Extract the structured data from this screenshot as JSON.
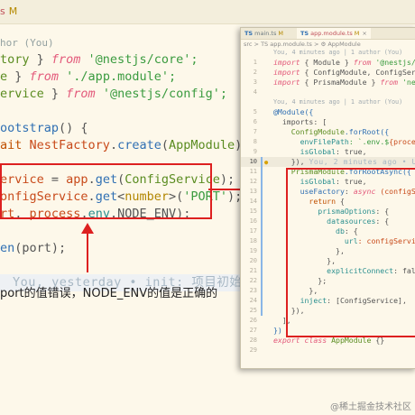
{
  "left_editor": {
    "tab": {
      "label": "s",
      "badge": "M"
    },
    "blame_top": "hor (You)",
    "lines": {
      "l1": {
        "a": "tory",
        "b": " } ",
        "c": "from",
        "d": " '@nestjs/core';"
      },
      "l2": {
        "a": "e",
        "b": " } ",
        "c": "from",
        "d": " './app.module';"
      },
      "l3": {
        "a": "ervice",
        "b": " } ",
        "c": "from",
        "d": " '@nestjs/config';"
      },
      "l4": {
        "a": "ootstrap",
        "b": "() {"
      },
      "l5": {
        "a": "ait",
        "b": " NestFactory",
        "c": ".",
        "d": "create",
        "e": "(",
        "f": "AppModule",
        "g": ");"
      },
      "l6": {
        "a": "ervice",
        "b": " = ",
        "c": "app",
        "d": ".",
        "e": "get",
        "f": "(",
        "g": "ConfigService",
        "h": ");"
      },
      "l7": {
        "a": "onfigService",
        "b": ".",
        "c": "get",
        "d": "<",
        "e": "number",
        "f": ">(",
        "g": "'PORT'",
        "h": ");"
      },
      "l8": {
        "a": "rt",
        "b": ", ",
        "c": "process",
        "d": ".",
        "e": "env",
        "f": ".NODE_ENV);"
      },
      "l9": {
        "a": "en",
        "b": "(port);"
      }
    },
    "yesterday_annotation": "You, yesterday • init: 项目初始化"
  },
  "caption": "port的值错误，NODE_ENV的值是正确的",
  "right_editor": {
    "tabs": [
      {
        "badge": "TS",
        "label": "main.ts",
        "mod": "M"
      },
      {
        "badge": "TS",
        "label": "app.module.ts",
        "mod": "M",
        "close": "×"
      }
    ],
    "breadcrumb": "src > TS app.module.ts > ⚙ AppModule",
    "blame1": "You, 4 minutes ago | 1 author (You)",
    "imports": [
      {
        "kw": "import",
        "body": " { Module } ",
        "from": "from",
        "src": " '@nestjs/com"
      },
      {
        "kw": "import",
        "body": " { ConfigModule, ConfigServic"
      },
      {
        "kw": "import",
        "body": " { PrismaModule } ",
        "from": "from",
        "src": " 'nestj"
      }
    ],
    "blame2": "You, 4 minutes ago | 1 author (You)",
    "code": {
      "c7": "@Module({",
      "c8": "  imports: [",
      "c9a": "    ConfigModule",
      "c9b": ".forRoot({",
      "c10a": "      envFilePath",
      "c10b": ": `.env.$",
      "c10c": "{process.",
      "c11a": "      isGlobal",
      "c11b": ": true,",
      "c12a": "    }),",
      "c12b": "You, 2 minutes ago • U",
      "c13a": "    PrismaModule",
      "c13b": ".forRootAsync({",
      "c14a": "      isGlobal",
      "c14b": ": true,",
      "c15a": "      useFactory",
      "c15b": ": ",
      "c15c": "async",
      "c15d": " (configServ",
      "c16a": "        return",
      "c16b": " {",
      "c17a": "          prismaOptions",
      "c17b": ": {",
      "c18a": "            datasources",
      "c18b": ": {",
      "c19a": "              db",
      "c19b": ": {",
      "c20a": "                url",
      "c20b": ": configService.",
      "c21": "              },",
      "c22": "            },",
      "c23a": "            explicitConnect",
      "c23b": ": false,",
      "c24": "          };",
      "c25": "        },",
      "c26a": "      inject",
      "c26b": ": [ConfigService],",
      "c27": "    }),",
      "c28": "  ],",
      "c29": "})",
      "c30a": "export",
      "c30b": " class",
      "c30c": " AppModule",
      "c30d": " {}"
    },
    "line_numbers": [
      "1",
      "2",
      "3",
      "4",
      "5",
      "6",
      "7",
      "8",
      "9",
      "10",
      "11",
      "12",
      "13",
      "14",
      "15",
      "16",
      "17",
      "18",
      "19",
      "20",
      "21",
      "22",
      "23",
      "24",
      "25",
      "26",
      "27",
      "28",
      "29"
    ]
  },
  "watermark": "@稀土掘金技术社区"
}
